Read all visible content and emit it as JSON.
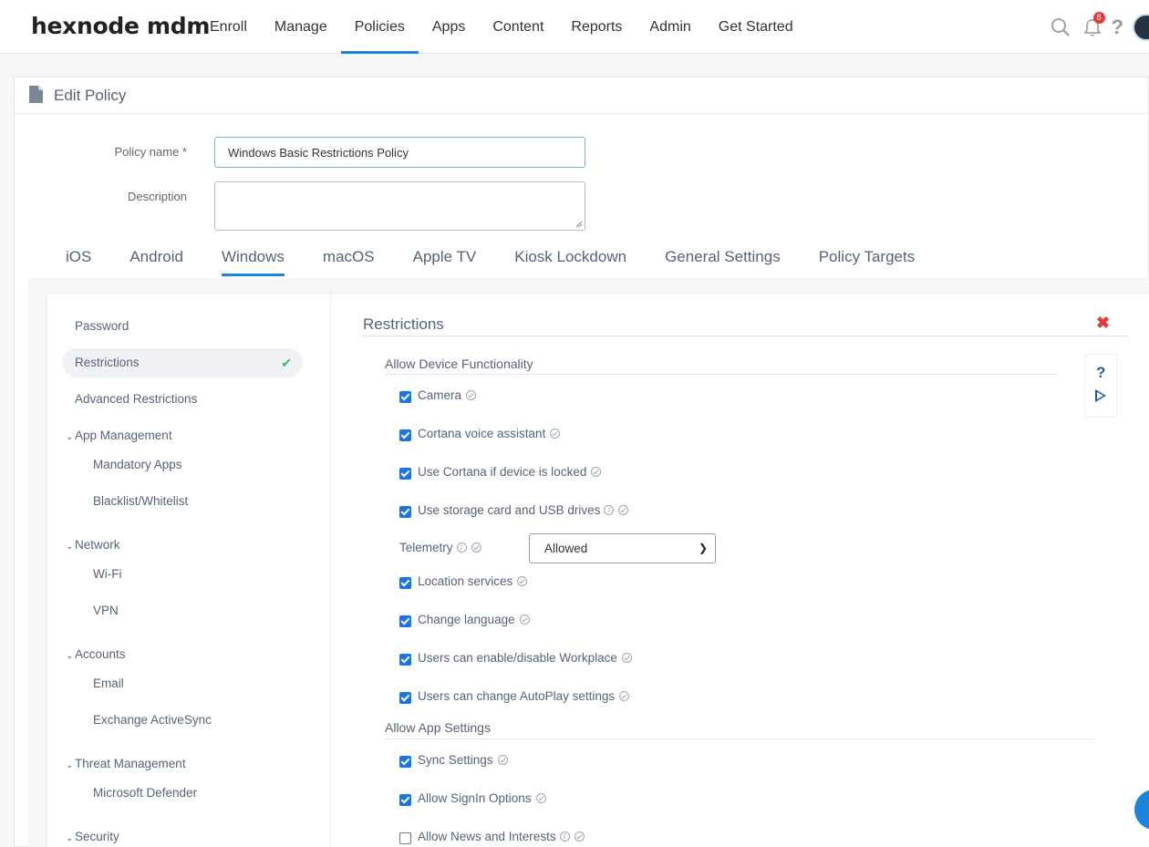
{
  "brand": {
    "logo_text": "hexnode mdm",
    "accent": "#1b84dd"
  },
  "nav": {
    "items": [
      "Enroll",
      "Manage",
      "Policies",
      "Apps",
      "Content",
      "Reports",
      "Admin",
      "Get Started"
    ],
    "active": "Policies"
  },
  "top_icons": {
    "search": "search-icon",
    "notifications": "bell-icon",
    "notification_count": "8",
    "help": "?",
    "avatar": "avatar"
  },
  "page": {
    "title": "Edit Policy"
  },
  "form": {
    "policy_name_label": "Policy name *",
    "policy_name_value": "Windows Basic Restrictions Policy",
    "description_label": "Description",
    "description_value": ""
  },
  "os_tabs": [
    "iOS",
    "Android",
    "Windows",
    "macOS",
    "Apple TV",
    "Kiosk Lockdown",
    "General Settings",
    "Policy Targets"
  ],
  "os_tab_active": "Windows",
  "left_menu": {
    "password": "Password",
    "restrictions": "Restrictions",
    "advanced_restrictions": "Advanced Restrictions",
    "app_management": "App Management",
    "mandatory_apps": "Mandatory Apps",
    "blacklist_whitelist": "Blacklist/Whitelist",
    "network": "Network",
    "wifi": "Wi-Fi",
    "vpn": "VPN",
    "accounts": "Accounts",
    "email": "Email",
    "exchange": "Exchange ActiveSync",
    "threat_management": "Threat Management",
    "defender": "Microsoft Defender",
    "security": "Security"
  },
  "restrictions": {
    "title": "Restrictions",
    "device_func_heading": "Allow Device Functionality",
    "camera": "Camera",
    "cortana": "Cortana voice assistant",
    "cortana_locked": "Use Cortana if device is locked",
    "storage": "Use storage card and USB drives",
    "telemetry_label": "Telemetry",
    "telemetry_value": "Allowed",
    "location": "Location services",
    "language": "Change language",
    "workplace": "Users can enable/disable Workplace",
    "autoplay": "Users can change AutoPlay settings",
    "app_settings_heading": "Allow App Settings",
    "sync": "Sync Settings",
    "signin": "Allow SignIn Options",
    "news": "Allow News and Interests"
  },
  "checkbox_states": {
    "camera": true,
    "cortana": true,
    "cortana_locked": true,
    "storage": true,
    "location": true,
    "language": true,
    "workplace": true,
    "autoplay": true,
    "sync": true,
    "signin": true,
    "news": false
  }
}
